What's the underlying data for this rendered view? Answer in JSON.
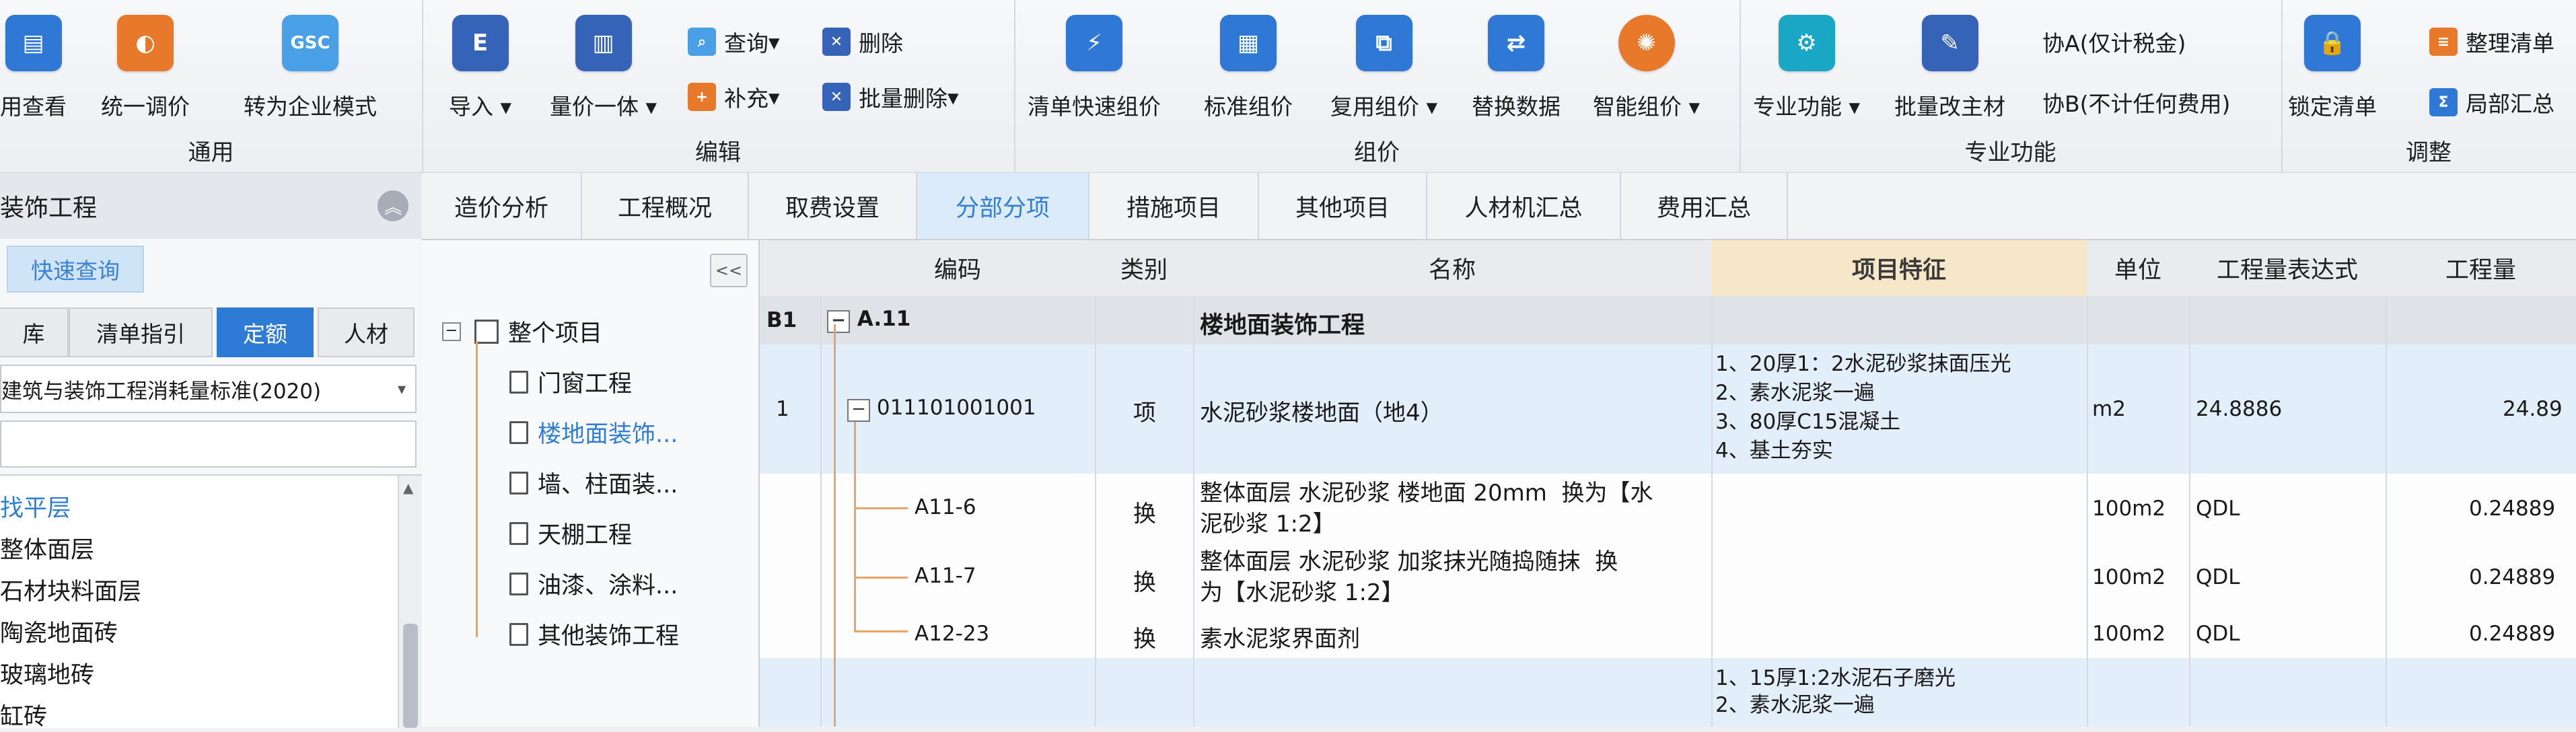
{
  "ribbon": {
    "groups": [
      {
        "label": "通用",
        "buttons": [
          "用查看",
          "统一调价",
          "转为企业模式"
        ]
      },
      {
        "label": "编辑",
        "buttons": [
          "导入",
          "量价一体",
          "查询",
          "删除",
          "补充",
          "批量删除"
        ]
      },
      {
        "label": "组价",
        "buttons": [
          "清单快速组价",
          "标准组价",
          "复用组价",
          "替换数据",
          "智能组价"
        ]
      },
      {
        "label": "专业功能",
        "buttons": [
          "专业功能",
          "批量改主材",
          "协A(仅计税金)",
          "协B(不计任何费用)"
        ]
      },
      {
        "label": "调整",
        "buttons": [
          "锁定清单",
          "整理清单",
          "局部汇总"
        ]
      }
    ],
    "icon_text": {
      "gsc": "GSC"
    }
  },
  "tabs": [
    "造价分析",
    "工程概况",
    "取费设置",
    "分部分项",
    "措施项目",
    "其他项目",
    "人材机汇总",
    "费用汇总"
  ],
  "left_panel": {
    "title": "装饰工程",
    "quick_query": "快速查询",
    "lib_tabs": [
      "库",
      "清单指引",
      "定额",
      "人材"
    ],
    "standard": "建筑与装饰工程消耗量标准(2020)",
    "list": [
      "找平层",
      "整体面层",
      "石材块料面层",
      "陶瓷地面砖",
      "玻璃地砖",
      "缸砖"
    ]
  },
  "tree": {
    "toggle": "<<",
    "root": "整个项目",
    "children": [
      "门窗工程",
      "楼地面装饰...",
      "墙、柱面装...",
      "天棚工程",
      "油漆、涂料...",
      "其他装饰工程"
    ]
  },
  "grid": {
    "headers": [
      "编码",
      "类别",
      "名称",
      "项目特征",
      "单位",
      "工程量表达式",
      "工程量"
    ],
    "section": {
      "no": "B1",
      "code": "A.11",
      "name": "楼地面装饰工程"
    },
    "rows": [
      {
        "no": "1",
        "code": "011101001001",
        "type": "项",
        "name": "水泥砂浆楼地面（地4）",
        "features": "1、20厚1：2水泥砂浆抹面压光\n2、素水泥浆一遍\n3、80厚C15混凝土\n4、基土夯实",
        "unit": "m2",
        "expr": "24.8886",
        "qty": "24.89"
      },
      {
        "no": "",
        "code": "A11-6",
        "type": "换",
        "name": "整体面层 水泥砂浆 楼地面 20mm  换为【水\n泥砂浆 1:2】",
        "features": "",
        "unit": "100m2",
        "expr": "QDL",
        "qty": "0.24889"
      },
      {
        "no": "",
        "code": "A11-7",
        "type": "换",
        "name": "整体面层 水泥砂浆 加浆抹光随捣随抹  换\n为【水泥砂浆 1:2】",
        "features": "",
        "unit": "100m2",
        "expr": "QDL",
        "qty": "0.24889"
      },
      {
        "no": "",
        "code": "A12-23",
        "type": "换",
        "name": "素水泥浆界面剂",
        "features": "",
        "unit": "100m2",
        "expr": "QDL",
        "qty": "0.24889"
      },
      {
        "no": "",
        "code": "",
        "type": "",
        "name": "",
        "features": "1、15厚1:2水泥石子磨光\n2、素水泥浆一遍",
        "unit": "",
        "expr": "",
        "qty": ""
      }
    ]
  }
}
